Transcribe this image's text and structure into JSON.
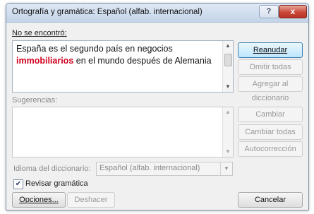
{
  "window": {
    "title": "Ortografía y gramática: Español (alfab. internacional)",
    "help_label": "?",
    "close_label": "x"
  },
  "not_found": {
    "label": "No se encontró:",
    "text_before": "España es el segundo país en negocios ",
    "error_word": "immobiliarios",
    "text_after": " en el mundo después de Alemania"
  },
  "suggestions": {
    "label": "Sugerencias:"
  },
  "buttons": {
    "resume": "Reanudar",
    "ignore_all": "Omitir todas",
    "add_dictionary": "Agregar al diccionario",
    "change": "Cambiar",
    "change_all": "Cambiar todas",
    "autocorrect": "Autocorrección",
    "options": "Opciones...",
    "undo": "Deshacer",
    "cancel": "Cancelar"
  },
  "dictionary": {
    "label": "Idioma del diccionario:",
    "value": "Español (alfab. internacional)"
  },
  "grammar_check": {
    "label": "Revisar gramática",
    "checked": true
  },
  "colors": {
    "error_text": "#d2001e",
    "primary_button": "#bee6fd"
  }
}
